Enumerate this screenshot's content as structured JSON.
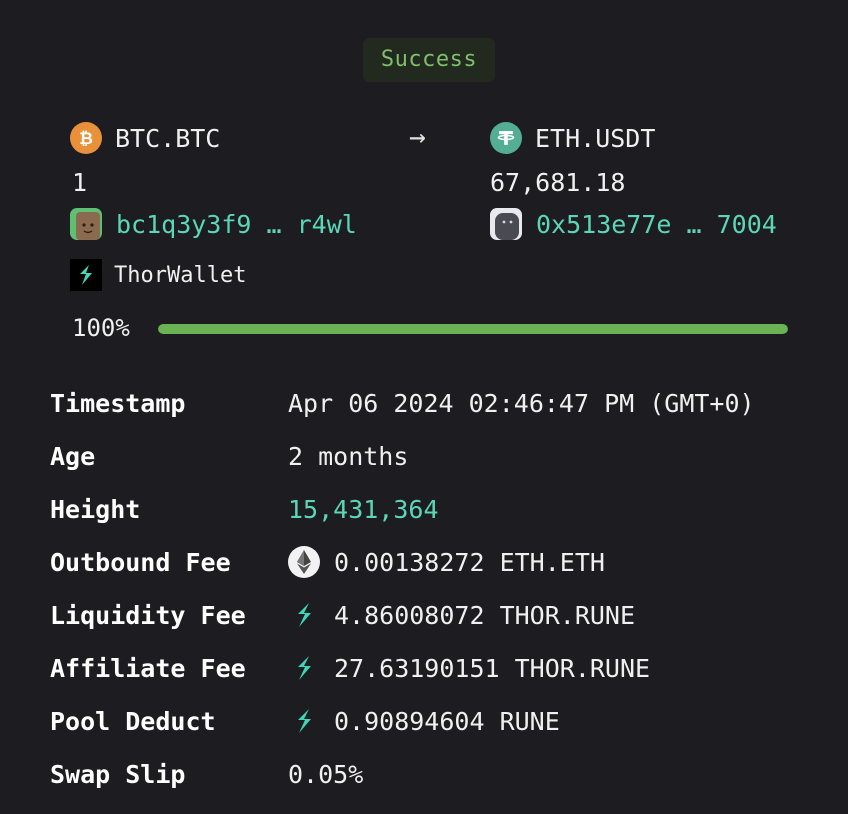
{
  "status": "Success",
  "swap": {
    "from_asset": "BTC.BTC",
    "to_asset": "ETH.USDT",
    "arrow": "→",
    "from_amount": "1",
    "to_amount": "67,681.18",
    "from_address": "bc1q3y3f9 … r4wl",
    "to_address": "0x513e77e … 7004"
  },
  "wallet": {
    "name": "ThorWallet"
  },
  "progress": {
    "label": "100%",
    "value": 1.0
  },
  "details": {
    "timestamp": {
      "label": "Timestamp",
      "value": "Apr 06 2024 02:46:47 PM (GMT+0)"
    },
    "age": {
      "label": "Age",
      "value": "2 months"
    },
    "height": {
      "label": "Height",
      "value": "15,431,364"
    },
    "outbound_fee": {
      "label": "Outbound Fee",
      "value": "0.00138272 ETH.ETH",
      "icon": "eth-icon"
    },
    "liquidity_fee": {
      "label": "Liquidity Fee",
      "value": "4.86008072 THOR.RUNE",
      "icon": "rune-icon"
    },
    "affiliate_fee": {
      "label": "Affiliate Fee",
      "value": "27.63190151 THOR.RUNE",
      "icon": "rune-icon"
    },
    "pool_deduct": {
      "label": "Pool Deduct",
      "value": "0.90894604 RUNE",
      "icon": "rune-icon"
    },
    "swap_slip": {
      "label": "Swap Slip",
      "value": "0.05%"
    }
  },
  "colors": {
    "background": "#1c1c21",
    "success": "#7fbf6c",
    "link": "#5bd6b8",
    "progress": "#6ab254",
    "btc": "#e8913a",
    "usdt": "#53ae94"
  }
}
